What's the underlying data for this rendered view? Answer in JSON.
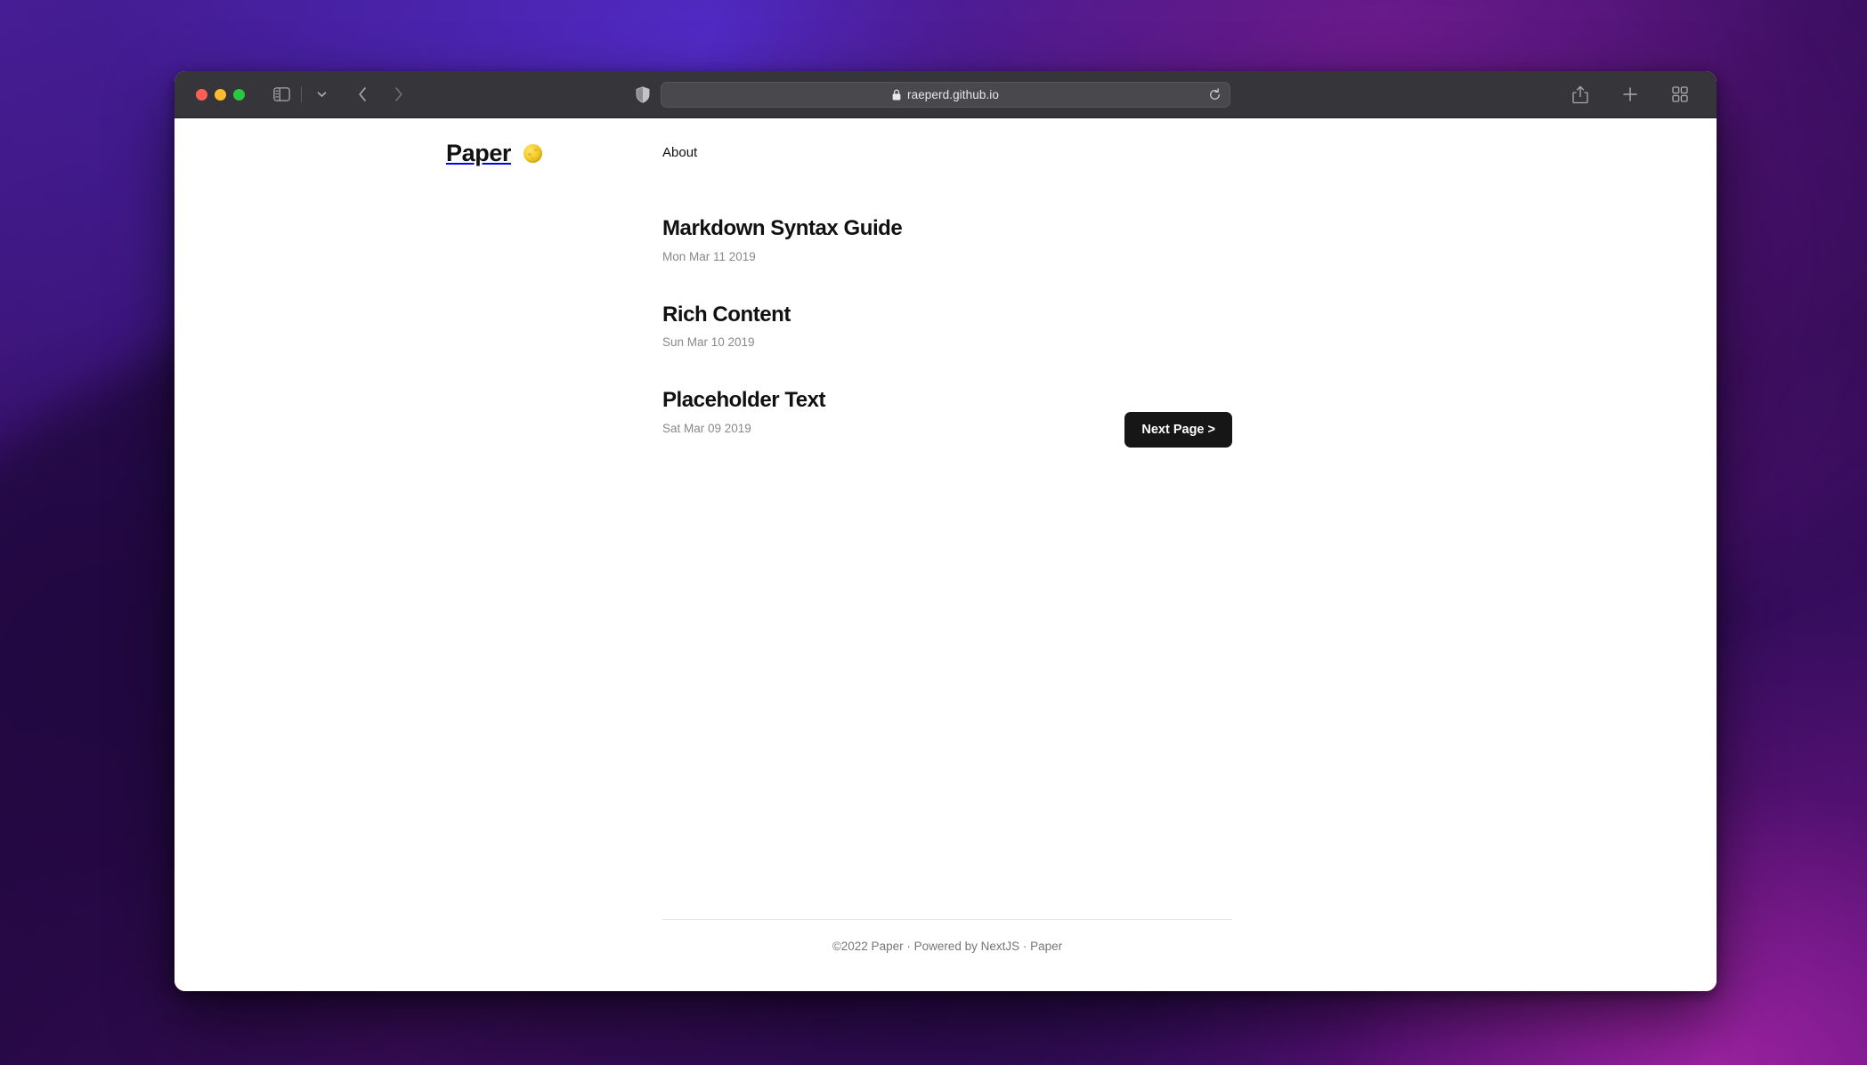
{
  "window": {
    "traffic_lights": [
      "close",
      "minimize",
      "zoom"
    ],
    "toolbar": {
      "sidebar_toggle": "sidebar-toggle-icon",
      "sidebar_dropdown": "chevron-down-icon",
      "back": "back-chevron-icon",
      "forward": "forward-chevron-icon",
      "privacy_shield": "shield-icon",
      "extension": "vimium-icon",
      "share": "share-icon",
      "new_tab": "plus-icon",
      "tab_overview": "tab-overview-icon"
    },
    "address_bar": {
      "lock": "lock-icon",
      "url": "raeperd.github.io",
      "reload": "reload-icon"
    }
  },
  "site": {
    "brand": {
      "title": "Paper",
      "emoji_name": "full-moon-emoji",
      "emoji": "🌕"
    },
    "nav": [
      {
        "label": "About"
      }
    ]
  },
  "posts": [
    {
      "title": "Markdown Syntax Guide",
      "date": "Mon Mar 11 2019"
    },
    {
      "title": "Rich Content",
      "date": "Sun Mar 10 2019"
    },
    {
      "title": "Placeholder Text",
      "date": "Sat Mar 09 2019"
    }
  ],
  "pagination": {
    "next_label": "Next Page >"
  },
  "footer": {
    "text": "©2022 Paper · Powered by NextJS ·  Paper"
  },
  "colors": {
    "toolbar_bg": "#36363a",
    "page_bg": "#ffffff",
    "text": "#111111",
    "muted": "#888888",
    "button_bg": "#161616",
    "accent_blue": "#3aa3f5",
    "moon_yellow": "#f5cf2c"
  }
}
